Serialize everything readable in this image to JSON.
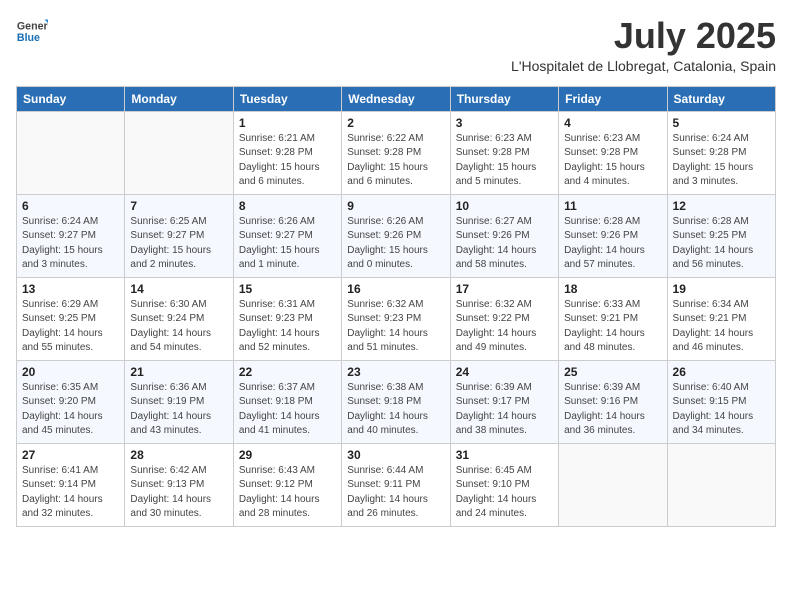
{
  "logo": {
    "general": "General",
    "blue": "Blue"
  },
  "header": {
    "month": "July 2025",
    "location": "L'Hospitalet de Llobregat, Catalonia, Spain"
  },
  "weekdays": [
    "Sunday",
    "Monday",
    "Tuesday",
    "Wednesday",
    "Thursday",
    "Friday",
    "Saturday"
  ],
  "weeks": [
    [
      {
        "day": null
      },
      {
        "day": null
      },
      {
        "day": "1",
        "sunrise": "Sunrise: 6:21 AM",
        "sunset": "Sunset: 9:28 PM",
        "daylight": "Daylight: 15 hours and 6 minutes."
      },
      {
        "day": "2",
        "sunrise": "Sunrise: 6:22 AM",
        "sunset": "Sunset: 9:28 PM",
        "daylight": "Daylight: 15 hours and 6 minutes."
      },
      {
        "day": "3",
        "sunrise": "Sunrise: 6:23 AM",
        "sunset": "Sunset: 9:28 PM",
        "daylight": "Daylight: 15 hours and 5 minutes."
      },
      {
        "day": "4",
        "sunrise": "Sunrise: 6:23 AM",
        "sunset": "Sunset: 9:28 PM",
        "daylight": "Daylight: 15 hours and 4 minutes."
      },
      {
        "day": "5",
        "sunrise": "Sunrise: 6:24 AM",
        "sunset": "Sunset: 9:28 PM",
        "daylight": "Daylight: 15 hours and 3 minutes."
      }
    ],
    [
      {
        "day": "6",
        "sunrise": "Sunrise: 6:24 AM",
        "sunset": "Sunset: 9:27 PM",
        "daylight": "Daylight: 15 hours and 3 minutes."
      },
      {
        "day": "7",
        "sunrise": "Sunrise: 6:25 AM",
        "sunset": "Sunset: 9:27 PM",
        "daylight": "Daylight: 15 hours and 2 minutes."
      },
      {
        "day": "8",
        "sunrise": "Sunrise: 6:26 AM",
        "sunset": "Sunset: 9:27 PM",
        "daylight": "Daylight: 15 hours and 1 minute."
      },
      {
        "day": "9",
        "sunrise": "Sunrise: 6:26 AM",
        "sunset": "Sunset: 9:26 PM",
        "daylight": "Daylight: 15 hours and 0 minutes."
      },
      {
        "day": "10",
        "sunrise": "Sunrise: 6:27 AM",
        "sunset": "Sunset: 9:26 PM",
        "daylight": "Daylight: 14 hours and 58 minutes."
      },
      {
        "day": "11",
        "sunrise": "Sunrise: 6:28 AM",
        "sunset": "Sunset: 9:26 PM",
        "daylight": "Daylight: 14 hours and 57 minutes."
      },
      {
        "day": "12",
        "sunrise": "Sunrise: 6:28 AM",
        "sunset": "Sunset: 9:25 PM",
        "daylight": "Daylight: 14 hours and 56 minutes."
      }
    ],
    [
      {
        "day": "13",
        "sunrise": "Sunrise: 6:29 AM",
        "sunset": "Sunset: 9:25 PM",
        "daylight": "Daylight: 14 hours and 55 minutes."
      },
      {
        "day": "14",
        "sunrise": "Sunrise: 6:30 AM",
        "sunset": "Sunset: 9:24 PM",
        "daylight": "Daylight: 14 hours and 54 minutes."
      },
      {
        "day": "15",
        "sunrise": "Sunrise: 6:31 AM",
        "sunset": "Sunset: 9:23 PM",
        "daylight": "Daylight: 14 hours and 52 minutes."
      },
      {
        "day": "16",
        "sunrise": "Sunrise: 6:32 AM",
        "sunset": "Sunset: 9:23 PM",
        "daylight": "Daylight: 14 hours and 51 minutes."
      },
      {
        "day": "17",
        "sunrise": "Sunrise: 6:32 AM",
        "sunset": "Sunset: 9:22 PM",
        "daylight": "Daylight: 14 hours and 49 minutes."
      },
      {
        "day": "18",
        "sunrise": "Sunrise: 6:33 AM",
        "sunset": "Sunset: 9:21 PM",
        "daylight": "Daylight: 14 hours and 48 minutes."
      },
      {
        "day": "19",
        "sunrise": "Sunrise: 6:34 AM",
        "sunset": "Sunset: 9:21 PM",
        "daylight": "Daylight: 14 hours and 46 minutes."
      }
    ],
    [
      {
        "day": "20",
        "sunrise": "Sunrise: 6:35 AM",
        "sunset": "Sunset: 9:20 PM",
        "daylight": "Daylight: 14 hours and 45 minutes."
      },
      {
        "day": "21",
        "sunrise": "Sunrise: 6:36 AM",
        "sunset": "Sunset: 9:19 PM",
        "daylight": "Daylight: 14 hours and 43 minutes."
      },
      {
        "day": "22",
        "sunrise": "Sunrise: 6:37 AM",
        "sunset": "Sunset: 9:18 PM",
        "daylight": "Daylight: 14 hours and 41 minutes."
      },
      {
        "day": "23",
        "sunrise": "Sunrise: 6:38 AM",
        "sunset": "Sunset: 9:18 PM",
        "daylight": "Daylight: 14 hours and 40 minutes."
      },
      {
        "day": "24",
        "sunrise": "Sunrise: 6:39 AM",
        "sunset": "Sunset: 9:17 PM",
        "daylight": "Daylight: 14 hours and 38 minutes."
      },
      {
        "day": "25",
        "sunrise": "Sunrise: 6:39 AM",
        "sunset": "Sunset: 9:16 PM",
        "daylight": "Daylight: 14 hours and 36 minutes."
      },
      {
        "day": "26",
        "sunrise": "Sunrise: 6:40 AM",
        "sunset": "Sunset: 9:15 PM",
        "daylight": "Daylight: 14 hours and 34 minutes."
      }
    ],
    [
      {
        "day": "27",
        "sunrise": "Sunrise: 6:41 AM",
        "sunset": "Sunset: 9:14 PM",
        "daylight": "Daylight: 14 hours and 32 minutes."
      },
      {
        "day": "28",
        "sunrise": "Sunrise: 6:42 AM",
        "sunset": "Sunset: 9:13 PM",
        "daylight": "Daylight: 14 hours and 30 minutes."
      },
      {
        "day": "29",
        "sunrise": "Sunrise: 6:43 AM",
        "sunset": "Sunset: 9:12 PM",
        "daylight": "Daylight: 14 hours and 28 minutes."
      },
      {
        "day": "30",
        "sunrise": "Sunrise: 6:44 AM",
        "sunset": "Sunset: 9:11 PM",
        "daylight": "Daylight: 14 hours and 26 minutes."
      },
      {
        "day": "31",
        "sunrise": "Sunrise: 6:45 AM",
        "sunset": "Sunset: 9:10 PM",
        "daylight": "Daylight: 14 hours and 24 minutes."
      },
      {
        "day": null
      },
      {
        "day": null
      }
    ]
  ]
}
